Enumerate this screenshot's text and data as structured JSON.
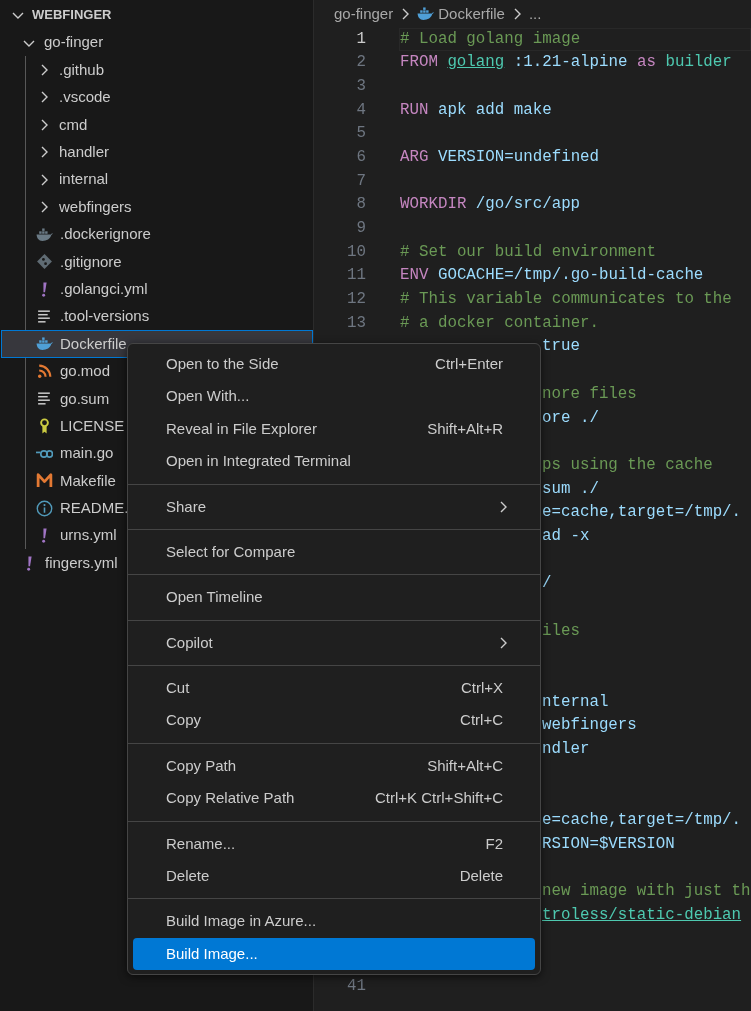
{
  "explorer": {
    "title": "WEBFINGER",
    "expanded": true,
    "tree": [
      {
        "label": "go-finger",
        "kind": "folder",
        "expanded": true,
        "selected": false,
        "children": [
          {
            "label": ".github",
            "kind": "folder",
            "expanded": false,
            "selected": false
          },
          {
            "label": ".vscode",
            "kind": "folder",
            "expanded": false,
            "selected": false
          },
          {
            "label": "cmd",
            "kind": "folder",
            "expanded": false,
            "selected": false
          },
          {
            "label": "handler",
            "kind": "folder",
            "expanded": false,
            "selected": false
          },
          {
            "label": "internal",
            "kind": "folder",
            "expanded": false,
            "selected": false
          },
          {
            "label": "webfingers",
            "kind": "folder",
            "expanded": false,
            "selected": false
          },
          {
            "label": ".dockerignore",
            "kind": "dockerignore",
            "selected": false
          },
          {
            "label": ".gitignore",
            "kind": "git",
            "selected": false
          },
          {
            "label": ".golangci.yml",
            "kind": "yaml",
            "selected": false
          },
          {
            "label": ".tool-versions",
            "kind": "text",
            "selected": false
          },
          {
            "label": "Dockerfile",
            "kind": "docker",
            "selected": true
          },
          {
            "label": "go.mod",
            "kind": "gomod",
            "selected": false
          },
          {
            "label": "go.sum",
            "kind": "text",
            "selected": false
          },
          {
            "label": "LICENSE",
            "kind": "license",
            "selected": false
          },
          {
            "label": "main.go",
            "kind": "go",
            "selected": false
          },
          {
            "label": "Makefile",
            "kind": "makefile",
            "selected": false
          },
          {
            "label": "README.",
            "kind": "info",
            "selected": false
          },
          {
            "label": "urns.yml",
            "kind": "yaml",
            "selected": false
          }
        ]
      },
      {
        "label": "fingers.yml",
        "kind": "yaml",
        "selected": false
      }
    ]
  },
  "breadcrumb": [
    "go-finger",
    "Dockerfile",
    "..."
  ],
  "code_lines": [
    {
      "number": "1",
      "kind": "code",
      "current": true,
      "tokens": [
        {
          "kind": "comment",
          "text": "# Load golang image"
        }
      ]
    },
    {
      "number": "2",
      "kind": "code",
      "current": false,
      "tokens": [
        {
          "kind": "keyword",
          "text": "FROM"
        },
        {
          "kind": "link",
          "text": "golang"
        },
        {
          "kind": "value",
          "text": ":1.21-alpine"
        },
        {
          "kind": "keyword",
          "text": "as"
        },
        {
          "kind": "name",
          "text": "builder"
        }
      ]
    },
    {
      "number": "3",
      "kind": "blank",
      "current": false
    },
    {
      "number": "4",
      "kind": "code",
      "current": false,
      "tokens": [
        {
          "kind": "keyword",
          "text": "RUN"
        },
        {
          "kind": "value",
          "text": "apk add make"
        }
      ]
    },
    {
      "number": "5",
      "kind": "blank",
      "current": false
    },
    {
      "number": "6",
      "kind": "code",
      "current": false,
      "tokens": [
        {
          "kind": "keyword",
          "text": "ARG"
        },
        {
          "kind": "value",
          "text": "VERSION=undefined"
        }
      ]
    },
    {
      "number": "7",
      "kind": "blank",
      "current": false
    },
    {
      "number": "8",
      "kind": "code",
      "current": false,
      "tokens": [
        {
          "kind": "keyword",
          "text": "WORKDIR"
        },
        {
          "kind": "value",
          "text": "/go/src/app"
        }
      ]
    },
    {
      "number": "9",
      "kind": "blank",
      "current": false
    },
    {
      "number": "10",
      "kind": "code",
      "current": false,
      "tokens": [
        {
          "kind": "comment",
          "text": "# Set our build environment"
        }
      ]
    },
    {
      "number": "11",
      "kind": "code",
      "current": false,
      "tokens": [
        {
          "kind": "keyword",
          "text": "ENV"
        },
        {
          "kind": "value",
          "text": "GOCACHE=/tmp/.go-build-cache"
        }
      ]
    },
    {
      "number": "12",
      "kind": "code",
      "current": false,
      "tokens": [
        {
          "kind": "comment",
          "text": "# This variable communicates to the"
        }
      ]
    },
    {
      "number": "13",
      "kind": "code",
      "current": false,
      "tokens": [
        {
          "kind": "comment",
          "text": "# a docker container."
        }
      ]
    },
    {
      "kind": "code",
      "tokens": [
        {
          "kind": "value",
          "text": "true"
        }
      ]
    },
    {
      "kind": "blank"
    },
    {
      "kind": "code",
      "tokens": [
        {
          "kind": "comment",
          "text": "nore files"
        }
      ]
    },
    {
      "kind": "code",
      "tokens": [
        {
          "kind": "value",
          "text": "ore ./"
        }
      ]
    },
    {
      "kind": "blank"
    },
    {
      "kind": "code",
      "tokens": [
        {
          "kind": "comment",
          "text": "ps using the cache"
        }
      ]
    },
    {
      "kind": "code",
      "tokens": [
        {
          "kind": "value",
          "text": "sum ./"
        }
      ]
    },
    {
      "kind": "code",
      "tokens": [
        {
          "kind": "value",
          "text": "e=cache,target=/tmp/."
        }
      ]
    },
    {
      "kind": "code",
      "tokens": [
        {
          "kind": "value",
          "text": "ad -x"
        }
      ]
    },
    {
      "kind": "blank"
    },
    {
      "kind": "code",
      "tokens": [
        {
          "kind": "value",
          "text": "/"
        }
      ]
    },
    {
      "kind": "blank"
    },
    {
      "kind": "code",
      "tokens": [
        {
          "kind": "comment",
          "text": "iles"
        }
      ]
    },
    {
      "kind": "blank"
    },
    {
      "kind": "blank"
    },
    {
      "kind": "code",
      "tokens": [
        {
          "kind": "value",
          "text": "nternal"
        }
      ]
    },
    {
      "kind": "code",
      "tokens": [
        {
          "kind": "value",
          "text": "webfingers"
        }
      ]
    },
    {
      "kind": "code",
      "tokens": [
        {
          "kind": "value",
          "text": "ndler"
        }
      ]
    },
    {
      "kind": "blank"
    },
    {
      "kind": "blank"
    },
    {
      "kind": "code",
      "tokens": [
        {
          "kind": "value",
          "text": "e=cache,target=/tmp/."
        }
      ]
    },
    {
      "kind": "code",
      "tokens": [
        {
          "kind": "value",
          "text": "RSION=$VERSION"
        }
      ]
    },
    {
      "kind": "blank"
    },
    {
      "kind": "code",
      "tokens": [
        {
          "kind": "comment",
          "text": "new image with just th"
        }
      ]
    },
    {
      "kind": "code",
      "tokens": [
        {
          "kind": "link",
          "text": "troless/static-debian"
        }
      ]
    },
    {
      "kind": "blank"
    },
    {
      "kind": "blank"
    },
    {
      "number": "41",
      "kind": "blank",
      "current": false
    }
  ],
  "context_menu": {
    "groups": [
      [
        {
          "label": "Open to the Side",
          "shortcut": "Ctrl+Enter",
          "submenu": false,
          "selected": false
        },
        {
          "label": "Open With...",
          "submenu": false,
          "selected": false
        },
        {
          "label": "Reveal in File Explorer",
          "shortcut": "Shift+Alt+R",
          "submenu": false,
          "selected": false
        },
        {
          "label": "Open in Integrated Terminal",
          "submenu": false,
          "selected": false
        }
      ],
      [
        {
          "label": "Share",
          "submenu": true,
          "selected": false
        }
      ],
      [
        {
          "label": "Select for Compare",
          "submenu": false,
          "selected": false
        }
      ],
      [
        {
          "label": "Open Timeline",
          "submenu": false,
          "selected": false
        }
      ],
      [
        {
          "label": "Copilot",
          "submenu": true,
          "selected": false
        }
      ],
      [
        {
          "label": "Cut",
          "shortcut": "Ctrl+X",
          "submenu": false,
          "selected": false
        },
        {
          "label": "Copy",
          "shortcut": "Ctrl+C",
          "submenu": false,
          "selected": false
        }
      ],
      [
        {
          "label": "Copy Path",
          "shortcut": "Shift+Alt+C",
          "submenu": false,
          "selected": false
        },
        {
          "label": "Copy Relative Path",
          "shortcut": "Ctrl+K Ctrl+Shift+C",
          "submenu": false,
          "selected": false
        }
      ],
      [
        {
          "label": "Rename...",
          "shortcut": "F2",
          "submenu": false,
          "selected": false
        },
        {
          "label": "Delete",
          "shortcut": "Delete",
          "submenu": false,
          "selected": false
        }
      ],
      [
        {
          "label": "Build Image in Azure...",
          "submenu": false,
          "selected": false
        },
        {
          "label": "Build Image...",
          "submenu": false,
          "selected": true
        }
      ]
    ]
  }
}
